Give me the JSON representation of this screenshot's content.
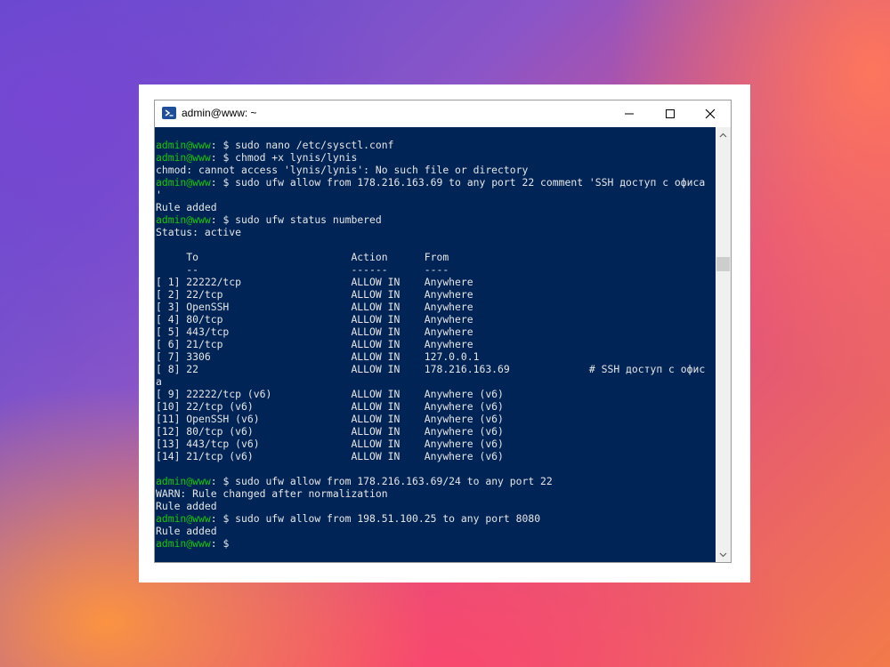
{
  "window": {
    "title": "admin@www: ~",
    "controls": {
      "minimize": "minimize-icon",
      "maximize": "maximize-icon",
      "close": "close-icon"
    }
  },
  "colors": {
    "terminal_bg": "#012456",
    "prompt_user": "#16c60c",
    "text": "#e6e6e6"
  },
  "terminal": {
    "prompt": "admin@www",
    "lines": [
      {
        "p": "admin@www",
        "t": ": $ sudo nano /etc/sysctl.conf"
      },
      {
        "p": "admin@www",
        "t": ": $ chmod +x lynis/lynis"
      },
      {
        "p": "",
        "t": "chmod: cannot access 'lynis/lynis': No such file or directory"
      },
      {
        "p": "admin@www",
        "t": ": $ sudo ufw allow from 178.216.163.69 to any port 22 comment 'SSH доступ с офиса"
      },
      {
        "p": "",
        "t": "'"
      },
      {
        "p": "",
        "t": "Rule added"
      },
      {
        "p": "admin@www",
        "t": ": $ sudo ufw status numbered"
      },
      {
        "p": "",
        "t": "Status: active"
      },
      {
        "p": "",
        "t": ""
      },
      {
        "p": "",
        "t": "     To                         Action      From"
      },
      {
        "p": "",
        "t": "     --                         ------      ----"
      },
      {
        "p": "",
        "t": "[ 1] 22222/tcp                  ALLOW IN    Anywhere"
      },
      {
        "p": "",
        "t": "[ 2] 22/tcp                     ALLOW IN    Anywhere"
      },
      {
        "p": "",
        "t": "[ 3] OpenSSH                    ALLOW IN    Anywhere"
      },
      {
        "p": "",
        "t": "[ 4] 80/tcp                     ALLOW IN    Anywhere"
      },
      {
        "p": "",
        "t": "[ 5] 443/tcp                    ALLOW IN    Anywhere"
      },
      {
        "p": "",
        "t": "[ 6] 21/tcp                     ALLOW IN    Anywhere"
      },
      {
        "p": "",
        "t": "[ 7] 3306                       ALLOW IN    127.0.0.1"
      },
      {
        "p": "",
        "t": "[ 8] 22                         ALLOW IN    178.216.163.69             # SSH доступ с офис"
      },
      {
        "p": "",
        "t": "а"
      },
      {
        "p": "",
        "t": "[ 9] 22222/tcp (v6)             ALLOW IN    Anywhere (v6)"
      },
      {
        "p": "",
        "t": "[10] 22/tcp (v6)                ALLOW IN    Anywhere (v6)"
      },
      {
        "p": "",
        "t": "[11] OpenSSH (v6)               ALLOW IN    Anywhere (v6)"
      },
      {
        "p": "",
        "t": "[12] 80/tcp (v6)                ALLOW IN    Anywhere (v6)"
      },
      {
        "p": "",
        "t": "[13] 443/tcp (v6)               ALLOW IN    Anywhere (v6)"
      },
      {
        "p": "",
        "t": "[14] 21/tcp (v6)                ALLOW IN    Anywhere (v6)"
      },
      {
        "p": "",
        "t": ""
      },
      {
        "p": "admin@www",
        "t": ": $ sudo ufw allow from 178.216.163.69/24 to any port 22"
      },
      {
        "p": "",
        "t": "WARN: Rule changed after normalization"
      },
      {
        "p": "",
        "t": "Rule added"
      },
      {
        "p": "admin@www",
        "t": ": $ sudo ufw allow from 198.51.100.25 to any port 8080"
      },
      {
        "p": "",
        "t": "Rule added"
      },
      {
        "p": "admin@www",
        "t": ": $"
      }
    ]
  },
  "scrollbar": {
    "up": "chevron-up-icon",
    "down": "chevron-down-icon"
  }
}
